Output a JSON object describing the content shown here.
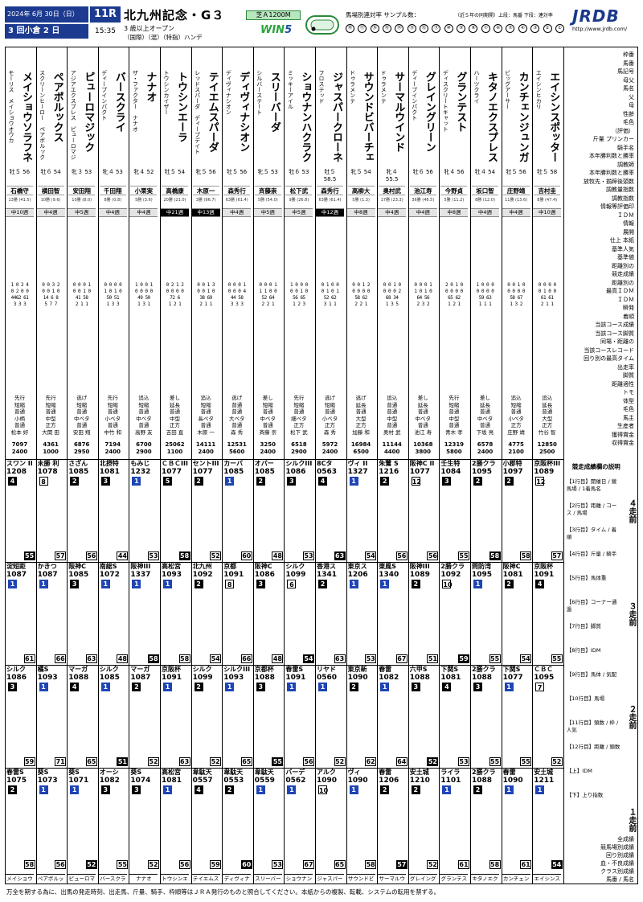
{
  "header": {
    "date": "2024年 6月 30日（日）",
    "round": "3 回小倉 2 日",
    "race_no": "11R",
    "start_time": "15:35",
    "title": "北九州記念・G３",
    "condition": "3 歳以上オープン",
    "condition2": "（国際）（混）（特指）ハンデ",
    "course": "芝Ａ1200M",
    "win5": "WIN",
    "win5_num": "5",
    "sample_label": "馬場別連対率 サンプル数：",
    "sample_note": "（近５年の同期開）上段：馬番 下段：連対率",
    "logo": "JRDB",
    "logo_url": "http://www.jrdb.com/",
    "numbers": [
      "⑱",
      "⑰",
      "⑯",
      "⑮",
      "⑭",
      "⑬",
      "⑫",
      "⑪",
      "⑩",
      "⑨",
      "⑧",
      "⑦",
      "⑥",
      "⑤",
      "④",
      "③",
      "②",
      "①"
    ]
  },
  "horses": [
    {
      "num": "18",
      "name": "メイショウソラフネ",
      "sire": "モーリス　メイショウオウカ",
      "weight": "牡５ 56",
      "jockey": "石橋守",
      "jstat": "13勝 (41.5)",
      "rank": "中10週",
      "bar_dark": false,
      "mini": "1 0 2 4\n0 2 0 0\n4462 61\n3 3 3",
      "style": "先行\n短縮\n普通\n小柄\n普通\n松本 好",
      "prize": "7097\n2400",
      "name_short": "メイショウ"
    },
    {
      "num": "17",
      "name": "ペアポルックス",
      "sire": "スクリーンヒーロー　ペアポルックス",
      "weight": "牡６ 54",
      "jockey": "横田智",
      "jstat": "10勝 (9.6)",
      "rank": "中4週",
      "bar_dark": false,
      "mini": "0 0 3 2\n0 0 1 0\n14 6 8\n5 7 7",
      "style": "先行\n短縮\n普通\n中型\n正方\n大関 田",
      "prize": "4361\n1000",
      "name_short": "ペアポルッ"
    },
    {
      "num": "16",
      "name": "ピューロマジック",
      "sire": "アジアエクスプレス　ピューロマジック",
      "weight": "牝３ 53",
      "jockey": "安田翔",
      "jstat": "10勝 (8.0)",
      "rank": "中5週",
      "bar_dark": false,
      "mini": "0 0 0 1\n0 0 1 0\n41 58\n2 1 1",
      "style": "逃げ\n短縮\n普通\n中ベタ\n普通\n安田 翔",
      "prize": "6876\n2950",
      "name_short": "ピューロマ"
    },
    {
      "num": "15",
      "name": "バースクライ",
      "sire": "ディープインパクト",
      "weight": "牝４ 53",
      "jockey": "千田翔",
      "jstat": "8勝 (0.8)",
      "rank": "中4週",
      "bar_dark": false,
      "mini": "0 0 0 0\n1 0 1 0\n50 51\n1 3 3",
      "style": "先行\n短縮\n普通\n小ベタ\n普通\n中竹 和",
      "prize": "7194\n2400",
      "name_short": "バースクラ"
    },
    {
      "num": "14",
      "name": "ナナオ",
      "sire": "ザ・ファクター　ナナオ",
      "weight": "牝４ 52",
      "jockey": "小栗実",
      "jstat": "5勝 (3.6)",
      "rank": "中4週",
      "bar_dark": false,
      "mini": "1 0 0 1\n0 0 0 0\n49 50\n1 3 1",
      "style": "追込\n短縮\n普通\n中ベタ\n普通\n高野 友",
      "prize": "6700\n2900",
      "name_short": "ナナオ"
    },
    {
      "num": "13",
      "name": "トウシンエーラ",
      "sire": "トウシンカイザー",
      "weight": "牡５ 54",
      "jockey": "高橋康",
      "jstat": "20勝 (21.0)",
      "rank": "中21週",
      "bar_dark": true,
      "mini": "0 2 1 2\n0 0 0 0\n72 6\n1 2 1",
      "style": "差し\n延長\n普通\n中型\n正方\n吉田 直",
      "prize": "25062\n1100",
      "name_short": "トウシンエ"
    },
    {
      "num": "12",
      "name": "テイエムスパーダ",
      "sire": "レッドスパーダ　ディープデイト",
      "weight": "牝５ 56",
      "jockey": "木原一",
      "jstat": "3勝 (96.7)",
      "rank": "中13週",
      "bar_dark": true,
      "mini": "0 0 1 3\n0 0 1 0\n38 69\n2 1 1",
      "style": "追込\n短縮\n普通\n長ペタ\n普通\n木原 一",
      "prize": "14111\n2400",
      "name_short": "テイエムス"
    },
    {
      "num": "11",
      "name": "ディヴィナシオン",
      "sire": "ディヴィナシオン",
      "weight": "牡５ 56",
      "jockey": "森秀行",
      "jstat": "63勝 (61.4)",
      "rank": "中4週",
      "bar_dark": false,
      "mini": "0 0 0 1\n0 0 0 4\n44 58\n3 3 3",
      "style": "逃げ\n普通\n普通\n大ベタ\n普通\n森 秀",
      "prize": "12531\n5600",
      "name_short": "ディヴィナ"
    },
    {
      "num": "10",
      "name": "スリーバーダ",
      "sire": "シルバーステート",
      "weight": "牝５ 53",
      "jockey": "斉藤崇",
      "jstat": "5勝 (54.0)",
      "rank": "中5週",
      "bar_dark": false,
      "mini": "0 0 0 1\n1 1 0 0\n52 64\n2 2 1",
      "style": "差し\n短縮\n普通\n中ベタ\n普通\n斉藤 崇",
      "prize": "3250\n2400",
      "name_short": "スリーバー"
    },
    {
      "num": "9",
      "name": "ショウナンハクラク",
      "sire": "ミッキーアイル",
      "weight": "牡６ 53",
      "jockey": "松下武",
      "jstat": "9勝 (26.8)",
      "rank": "中5週",
      "bar_dark": false,
      "mini": "1 0 0 0\n0 0 1 0\n56 65\n1 2 3",
      "style": "先行\n短縮\n普通\n細ペタ\n正方\n松下 武",
      "prize": "6518\n2900",
      "name_short": "ショウナン"
    },
    {
      "num": "8",
      "name": "ジャスパークローネ",
      "sire": "フロステッド",
      "weight": "牡５ 58.5",
      "jockey": "森秀行",
      "jstat": "63勝 (61.4)",
      "rank": "中12週",
      "bar_dark": true,
      "mini": "0 1 0 0\n0 1 0 1\n52 62\n3 1 1",
      "style": "逃げ\n短縮\n普通\n小ベタ\n正方\n森 秀",
      "prize": "5972\n2400",
      "name_short": "ジャスパー"
    },
    {
      "num": "7",
      "name": "サウンドビバーチェ",
      "sire": "ドゥラメンテ",
      "weight": "牝５ 54",
      "jockey": "高柳大",
      "jstat": "5勝 (1.3)",
      "rank": "中8週",
      "bar_dark": false,
      "mini": "0 0 1 2\n0 0 0 0\n58 62\n2 2 1",
      "style": "逃げ\n延長\n普通\n大型\n正方\n加藤 和",
      "prize": "16984\n6500",
      "name_short": "サウンドビ"
    },
    {
      "num": "6",
      "name": "サーマルウインド",
      "sire": "ドゥラメンテ",
      "weight": "牝４ 55.5",
      "jockey": "奥村武",
      "jstat": "17勝 (23.3)",
      "rank": "中4週",
      "bar_dark": false,
      "mini": "0 0 1 0\n0 0 0 2\n68 34\n1 3 5",
      "style": "追込\n普通\n普通\n中型\n普通\n奥村 武",
      "prize": "11144\n4400",
      "name_short": "サーマルウ"
    },
    {
      "num": "5",
      "name": "グレイングリーン",
      "sire": "ディープインパクト",
      "weight": "牡６ 56",
      "jockey": "池江寿",
      "jstat": "36勝 (46.5)",
      "rank": "中4週",
      "bar_dark": false,
      "mini": "0 0 0 1\n1 0 1 0\n64 56\n2 3 2",
      "style": "差し\n延長\n普通\n中ベタ\n普通\n池江 寿",
      "prize": "10368\n3800",
      "name_short": "グレイング"
    },
    {
      "num": "4",
      "name": "グランテスト",
      "sire": "ディスクリートキャット",
      "weight": "牝４ 56",
      "jockey": "今野貞",
      "jstat": "5勝 (11.2)",
      "rank": "中8週",
      "bar_dark": false,
      "mini": "2 0 1 0\n0 0 0 0\n65 62\n1 2 1",
      "style": "先行\n短縮\n普通\n中型\n普通\n青木 孝",
      "prize": "12319\n5800",
      "name_short": "グランテス"
    },
    {
      "num": "3",
      "name": "キタノエクスプレス",
      "sire": "ハーツクライ",
      "weight": "牡４ 54",
      "jockey": "坂口智",
      "jstat": "8勝 (12.0)",
      "rank": "中4週",
      "bar_dark": false,
      "mini": "1 0 0 0\n0 0 0 0\n59 63\n1 1 1",
      "style": "差し\n延長\n普通\n中ベタ\n普通\n下坂 亮",
      "prize": "6578\n2400",
      "name_short": "キタノエク"
    },
    {
      "num": "2",
      "name": "カンチェンジュンガ",
      "sire": "ビッグアーサー",
      "weight": "牡５ 56",
      "jockey": "庄野靖",
      "jstat": "11勝 (13.6)",
      "rank": "中4週",
      "bar_dark": false,
      "mini": "0 0 1 0\n0 0 0 0\n58 67\n1 3 2",
      "style": "追込\n短縮\n普通\n小ベタ\n正方\n庄野 靖",
      "prize": "4775\n2100",
      "name_short": "カンチェン"
    },
    {
      "num": "1",
      "name": "エイシンスポッター",
      "sire": "エイシンヒカリ",
      "weight": "牡５ 58",
      "jockey": "吉村圭",
      "jstat": "8勝 (47.4)",
      "rank": "中10週",
      "bar_dark": false,
      "mini": "0 0 0 0\n0 1 0 0\n61 61\n2 1 1",
      "style": "追込\n延長\n普通\n大型\n正方\n竹谷 智",
      "prize": "12850\n2500",
      "name_short": "エイシンス"
    }
  ],
  "runs": [
    [
      "スワン II",
      "未勝 利",
      "さざん",
      "北摂特",
      "もみじ",
      "ＣＢＣIII",
      "セントIII",
      "カーバ",
      "オパー",
      "シルクIII",
      "8Cタ",
      "ヴィ II",
      "朱鷺 S",
      "阪神C II",
      "壬生特",
      "2勝クラ",
      "小郡特",
      "京阪杯III"
    ],
    [
      "淀短距",
      "かきつ",
      "阪神C",
      "南総S",
      "阪神III",
      "高松宮",
      "北九州",
      "京都",
      "阪神C",
      "シルク",
      "香港ス",
      "東京ス",
      "東風S",
      "阪神III",
      "2勝クラ",
      "問防湾",
      "阪神C",
      "京阪杯"
    ],
    [
      "シルク",
      "橘S",
      "マーガ",
      "シルク",
      "マーガ",
      "京阪杯",
      "シルク",
      "シルクIII",
      "京都杯",
      "春雷S",
      "リヤド",
      "東京新",
      "春雷",
      "六甲S",
      "下関S",
      "2勝クラ",
      "下関S",
      "ＣＢＣ"
    ],
    [
      "春雷S",
      "葵S",
      "葵S",
      "オーシ",
      "葵S",
      "高松宮",
      "韋駄天",
      "韋駄天",
      "韋駄天",
      "バーデ",
      "アルク",
      "ヴィ",
      "春雷",
      "安土城",
      "ライラ",
      "2勝クラ",
      "春雷",
      "安土城"
    ]
  ],
  "run_times": [
    [
      "1208",
      "1078",
      "1085",
      "1081",
      "1232",
      "1077",
      "1077",
      "1085",
      "1085",
      "1086",
      "0563",
      "1327",
      "1216",
      "1077",
      "1084",
      "1095",
      "1097",
      "1089"
    ],
    [
      "1087",
      "1087",
      "1085",
      "1072",
      "1337",
      "1093",
      "1092",
      "1091",
      "1086",
      "1099",
      "1341",
      "1206",
      "1340",
      "1089",
      "1092",
      "1095",
      "1081",
      "1091"
    ],
    [
      "1086",
      "1093",
      "1088",
      "1085",
      "1087",
      "1091",
      "1099",
      "1093",
      "1088",
      "1091",
      "0560",
      "1090",
      "1082",
      "1088",
      "1081",
      "1088",
      "1077",
      "1095"
    ],
    [
      "1075",
      "1073",
      "1071",
      "1082",
      "1074",
      "1081",
      "0557",
      "0553",
      "0559",
      "0562",
      "1090",
      "1090",
      "1206",
      "1210",
      "1101",
      "1088",
      "1090",
      "1211"
    ]
  ],
  "run_ranks": [
    [
      "4",
      "8",
      "2",
      "3",
      "1",
      "5",
      "2",
      "1",
      "2",
      "3",
      "4",
      "1",
      "2",
      "12",
      "3",
      "2",
      "2",
      "12"
    ],
    [
      "1",
      "1",
      "3",
      "1",
      "1",
      "1",
      "2",
      "8",
      "3",
      "6",
      "2",
      "1",
      "1",
      "2",
      "10",
      "1",
      "2",
      "4"
    ],
    [
      "3",
      "1",
      "4",
      "1",
      "2",
      "1",
      "2",
      "1",
      "3",
      "1",
      "1",
      "2",
      "1",
      "3",
      "4",
      "3",
      "1",
      "7"
    ],
    [
      "2",
      "1",
      "1",
      "3",
      "3",
      "1",
      "4",
      "2",
      "1",
      "1",
      "10",
      "1",
      "2",
      "2",
      "1",
      "2",
      "1",
      "1"
    ]
  ],
  "run_idm": [
    [
      "55",
      "57",
      "56",
      "44",
      "53",
      "58",
      "52",
      "60",
      "48",
      "53",
      "63",
      "54",
      "56",
      "56",
      "55",
      "58",
      "58",
      "57"
    ],
    [
      "61",
      "66",
      "63",
      "48",
      "58",
      "58",
      "54",
      "66",
      "48",
      "54",
      "63",
      "53",
      "67",
      "51",
      "59",
      "55",
      "54",
      "55"
    ],
    [
      "59",
      "71",
      "65",
      "51",
      "52",
      "63",
      "52",
      "65",
      "55",
      "56",
      "52",
      "62",
      "64",
      "52",
      "53",
      "55",
      "55",
      "52"
    ],
    [
      "58",
      "56",
      "52",
      "55",
      "52",
      "56",
      "59",
      "60",
      "53",
      "67",
      "65",
      "58",
      "57",
      "52",
      "61",
      "58",
      "61",
      "54"
    ]
  ],
  "legend": {
    "items": [
      "枠番",
      "馬番",
      "馬記号",
      "母父",
      "馬名",
      "父",
      "母",
      "性齢",
      "毛色",
      "（評価）",
      "斤量 プリンカー",
      "騎手名",
      "本年勝利数と勝率",
      "調教師",
      "本年勝利数と勝率",
      "放牧先・揃蹄後頭数",
      "調教量指数",
      "調教指数",
      "情報等評価印",
      "ＩＤＭ",
      "情報",
      "展開",
      "仕上 本紙",
      "基準人気",
      "基準値",
      "距離別の",
      "競走成績",
      "距離別の",
      "最高ＩＤＭ",
      "ＩＤＭ",
      "瞬発",
      "着順",
      "当該コース成績",
      "当該コース脚質",
      "同場・距離の",
      "当該コースレコード",
      "回り別の最高タイム",
      "出走率",
      "脚質",
      "距離適性",
      "トモ",
      "体型",
      "毛色",
      "馬主",
      "生産者",
      "獲得賞金",
      "収得賞金"
    ],
    "section_label": "過去成績集計",
    "note_title": "競走成績欄の説明",
    "notes": [
      "【1行目】開催日 / 競馬場 / 1着馬名",
      "【2行目】距離 / コース / 馬場",
      "【3行目】タイム / 着順",
      "【4行目】斤量 / 騎手",
      "【5行目】馬体重",
      "【6行目】コーナー通過",
      "【7行目】脚質",
      "【8行目】IDM",
      "【9行目】馬体 / 気配",
      "【10行目】馬場",
      "【11行目】頭数 / 枠 / 人気",
      "【12行目】距離 / 頭数",
      "【上】IDM",
      "【下】上り指数"
    ],
    "side_labels": [
      "４走前",
      "３走前",
      "２走前",
      "１走前"
    ],
    "bottom": [
      "全成績",
      "競馬場別成績",
      "回り別成績",
      "血・不良成績",
      "クラス別成績",
      "馬番 / 馬名"
    ]
  },
  "footer": "万全を期する為に、出馬の発走時刻、出走馬、斤量、騎手、枠順等はＪＲＡ発行のものと照合してください。本紙からの複製、転載、システムの転用を禁ずる。"
}
